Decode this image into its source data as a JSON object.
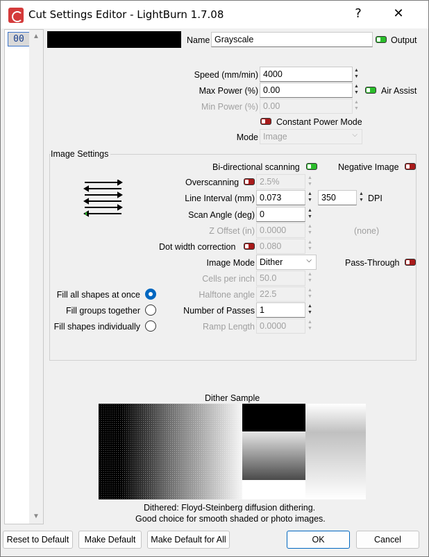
{
  "window": {
    "title": "Cut Settings Editor - LightBurn 1.7.08",
    "help_glyph": "?",
    "close_glyph": "✕"
  },
  "layer": {
    "label": "00",
    "color": "#000000"
  },
  "header": {
    "name_label": "Name",
    "name_value": "Grayscale",
    "output_label": "Output",
    "output_on": true
  },
  "main": {
    "speed_label": "Speed (mm/min)",
    "speed_value": "4000",
    "max_power_label": "Max Power (%)",
    "max_power_value": "0.00",
    "air_assist_label": "Air Assist",
    "air_assist_on": true,
    "min_power_label": "Min Power (%)",
    "min_power_value": "0.00",
    "constant_power_label": "Constant Power Mode",
    "constant_power_on": false,
    "mode_label": "Mode",
    "mode_value": "Image"
  },
  "image_settings": {
    "group_title": "Image Settings",
    "bidir_label": "Bi-directional scanning",
    "bidir_on": true,
    "negative_label": "Negative Image",
    "negative_on": false,
    "overscan_label": "Overscanning",
    "overscan_on": false,
    "overscan_value": "2.5%",
    "line_interval_label": "Line Interval (mm)",
    "line_interval_value": "0.073",
    "dpi_value": "350",
    "dpi_label": "DPI",
    "scan_angle_label": "Scan Angle (deg)",
    "scan_angle_value": "0",
    "z_offset_label": "Z Offset (in)",
    "z_offset_value": "0.0000",
    "z_offset_note": "(none)",
    "dot_width_label": "Dot width correction",
    "dot_width_on": false,
    "dot_width_value": "0.080",
    "image_mode_label": "Image Mode",
    "image_mode_value": "Dither",
    "pass_through_label": "Pass-Through",
    "pass_through_on": false,
    "cells_label": "Cells per inch",
    "cells_value": "50.0",
    "halftone_label": "Halftone angle",
    "halftone_value": "22.5",
    "passes_label": "Number of Passes",
    "passes_value": "1",
    "ramp_label": "Ramp Length",
    "ramp_value": "0.0000",
    "fill_options": [
      "Fill all shapes at once",
      "Fill groups together",
      "Fill shapes individually"
    ],
    "fill_selected": 0
  },
  "dither": {
    "title": "Dither Sample",
    "desc_line1": "Dithered: Floyd-Steinberg diffusion dithering.",
    "desc_line2": "Good choice for smooth shaded or photo images."
  },
  "footer": {
    "reset_label": "Reset to Default",
    "make_default_label": "Make Default",
    "make_default_all_label": "Make Default for All",
    "ok_label": "OK",
    "cancel_label": "Cancel"
  },
  "colors": {
    "toggle_on": "#2bbd2b",
    "toggle_off": "#a81a1a",
    "accent": "#0067c0"
  }
}
